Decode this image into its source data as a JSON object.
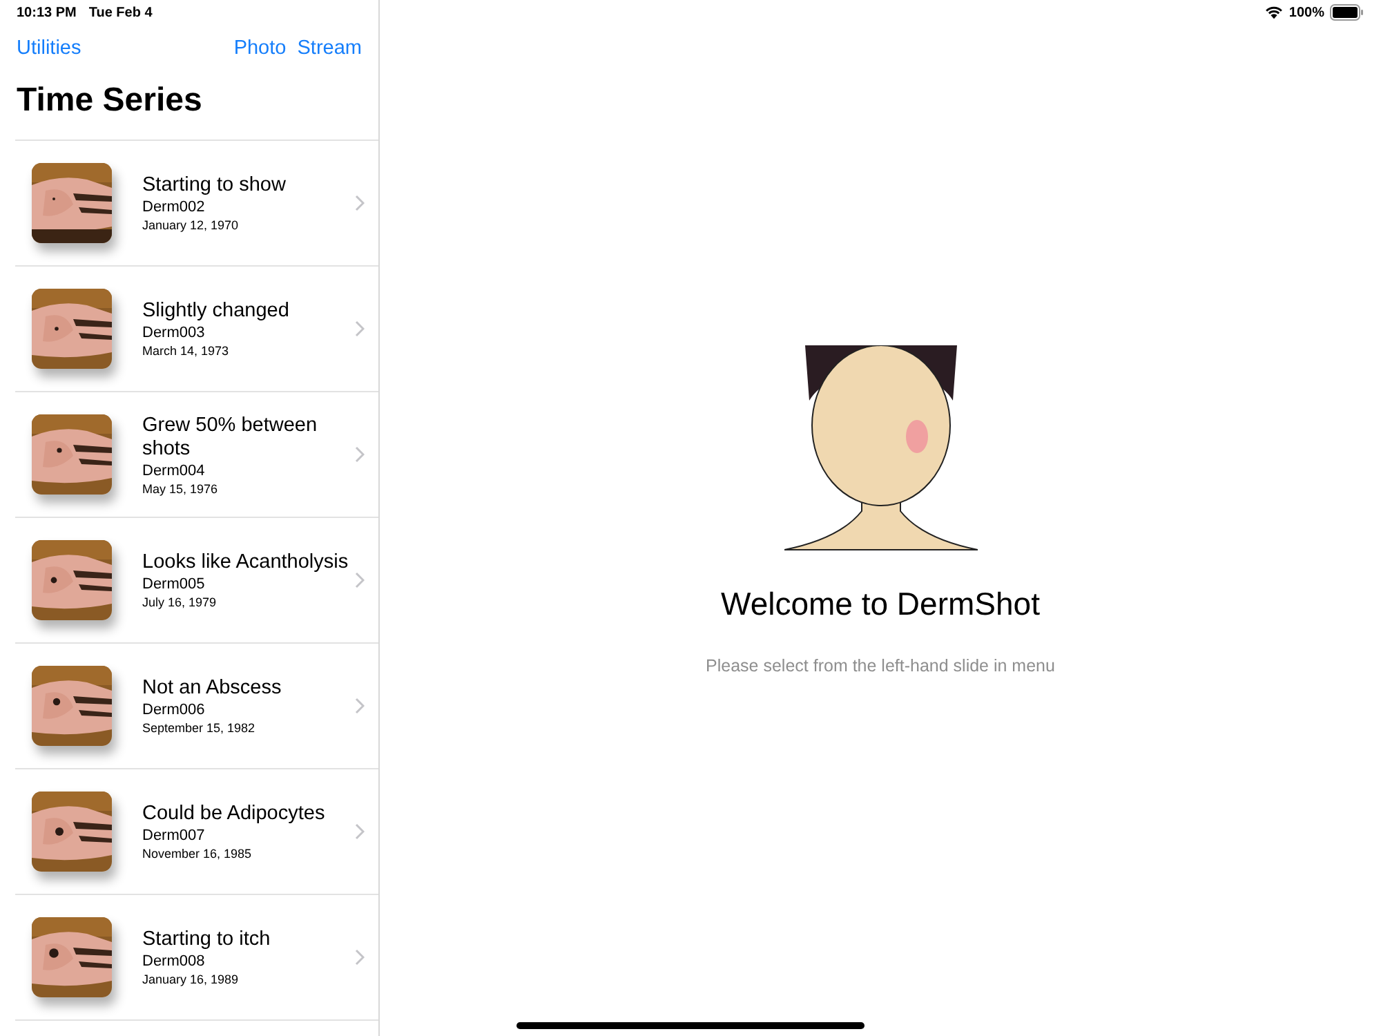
{
  "status_bar": {
    "time": "10:13 PM",
    "date": "Tue Feb 4",
    "battery": "100%"
  },
  "nav": {
    "left_button": "Utilities",
    "right_button": "Photo  Stream",
    "title": "Time Series"
  },
  "items": [
    {
      "title": "Starting to show",
      "id": "Derm002",
      "date": "January 12, 1970",
      "kind": "picture"
    },
    {
      "title": "Slightly changed",
      "id": "Derm003",
      "date": "March 14, 1973",
      "kind": "picture"
    },
    {
      "title": "Grew 50% between shots",
      "id": "Derm004",
      "date": "May 15, 1976",
      "kind": "picture"
    },
    {
      "title": "Looks like Acantholysis",
      "id": "Derm005",
      "date": "July 16, 1979",
      "kind": "picture"
    },
    {
      "title": "Not an Abscess",
      "id": "Derm006",
      "date": "September 15, 1982",
      "kind": "picture"
    },
    {
      "title": "Could be Adipocytes",
      "id": "Derm007",
      "date": "November 16, 1985",
      "kind": "picture"
    },
    {
      "title": "Starting to itch",
      "id": "Derm008",
      "date": "January 16, 1989",
      "kind": "picture"
    }
  ],
  "welcome": {
    "title": "Welcome to DermShot",
    "subtitle": "Please select from the left-hand slide in menu"
  }
}
